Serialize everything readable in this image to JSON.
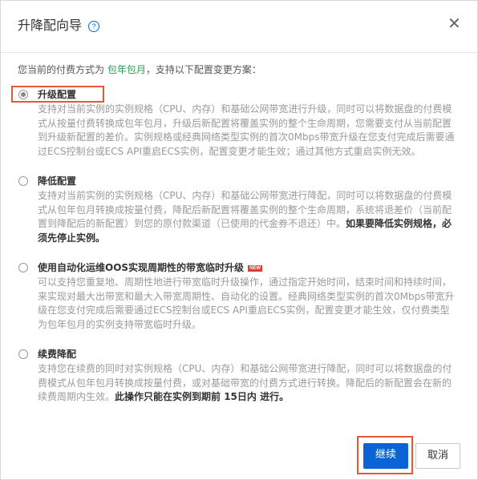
{
  "dialog": {
    "title": "升降配向导",
    "help_icon": "?",
    "close_icon": "✕"
  },
  "intro": {
    "prefix": "您当前的付费方式为",
    "payment_type": "包年包月",
    "suffix": "，支持以下配置变更方案："
  },
  "options": [
    {
      "label": "升级配置",
      "checked": true,
      "description": "支持对当前实例的实例规格（CPU、内存）和基础公网带宽进行升级，同时可以将数据盘的付费模式从按量付费转换成包年包月，升级后新配置将覆盖实例的整个生命周期，您需要支付从当前配置到升级新配置的差价。实例规格或经典网络类型实例的首次0Mbps带宽升级在您支付完成后需要通过ECS控制台或ECS API重启ECS实例，配置变更才能生效；通过其他方式重启实例无效。"
    },
    {
      "label": "降低配置",
      "checked": false,
      "description": "支持对当前实例的实例规格（CPU、内存）和基础公网带宽进行降配，同时可以将数据盘的付费模式从包年包月转换成按量付费，降配后新配置将覆盖实例的整个生命周期，系统将退差价（当前配置到降配后的新配置）到您的原付款渠道（已使用的代金券不退还）中。",
      "strong": "如果要降低实例规格，必须先停止实例。"
    },
    {
      "label": "使用自动化运维OOS实现周期性的带宽临时升级",
      "badge": "NEW",
      "checked": false,
      "description": "可以支持您重复地、周期性地进行带宽临时升级操作，通过指定开始时间，结束时间和持续时间，来实现对最大出带宽和最大入带宽周期性、自动化的设置。经典网络类型实例的首次0Mbps带宽升级在您支付完成后需要通过ECS控制台或ECS API重启ECS实例，配置变更才能生效，仅付费类型为包年包月的实例支持带宽临时升级。"
    },
    {
      "label": "续费降配",
      "checked": false,
      "description": "支持您在续费的同时对实例规格（CPU、内存）和基础公网带宽进行降配，同时可以将数据盘的付费模式从包年包月转换成按量付费，或对基础带宽的付费方式进行转换。降配后的新配置会在新的续费周期内生效。",
      "strong": "此操作只能在实例到期前 15日内 进行。"
    }
  ],
  "footer": {
    "continue_label": "继续",
    "cancel_label": "取消"
  },
  "colors": {
    "primary": "#0b63d6",
    "highlight": "#e05a3a",
    "payment_type": "#2a9d54"
  }
}
